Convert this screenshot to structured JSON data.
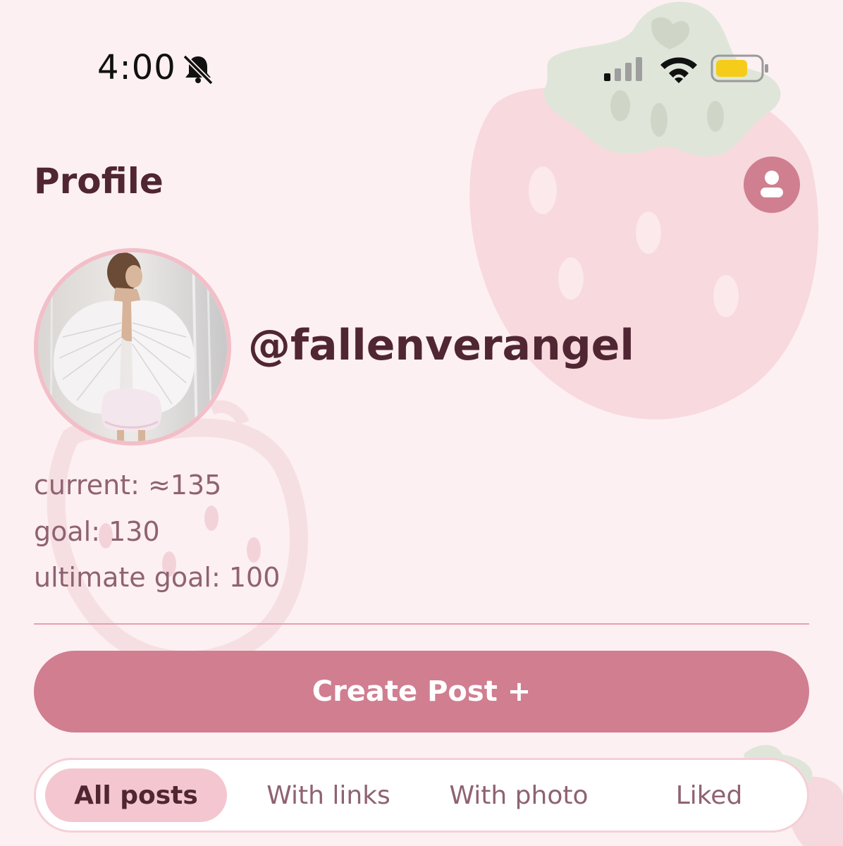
{
  "status_bar": {
    "time": "4:00",
    "icons": [
      "bell-slash-icon",
      "cellular-signal-icon",
      "wifi-icon",
      "battery-icon"
    ],
    "battery_color": "#f5cc1a"
  },
  "header": {
    "title": "Profile",
    "account_icon": "user-circle-icon"
  },
  "profile": {
    "username": "@fallenverangel",
    "stats": {
      "current": "current: ≈135",
      "goal": "goal: 130",
      "ultimate_goal": "ultimate goal: 100"
    }
  },
  "actions": {
    "create_post_label": "Create Post +"
  },
  "tabs": [
    {
      "label": "All posts",
      "selected": true
    },
    {
      "label": "With links",
      "selected": false
    },
    {
      "label": "With photo",
      "selected": false
    },
    {
      "label": "Liked",
      "selected": false
    }
  ],
  "colors": {
    "background": "#fdf0f2",
    "accent": "#d07e90",
    "title_text": "#4f2632",
    "muted_text": "#8f6272",
    "selected_tab": "#f4c6cf"
  }
}
